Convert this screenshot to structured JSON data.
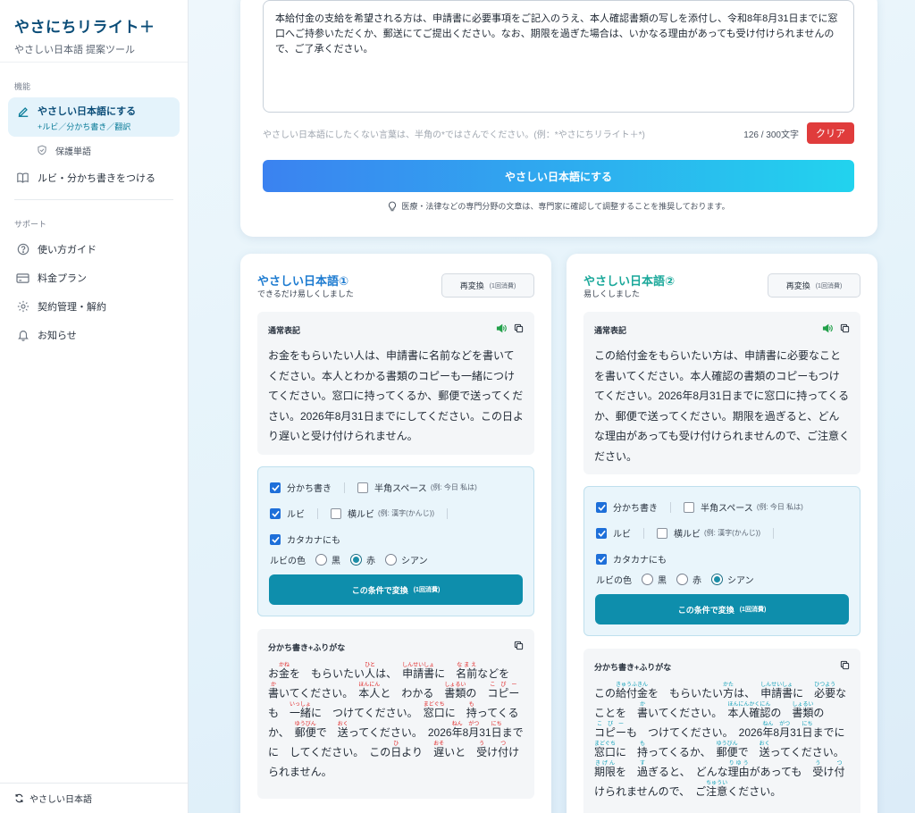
{
  "sidebar": {
    "brand_title": "やさにちリライト＋",
    "brand_sub": "やさしい日本語 提案ツール",
    "section_features": "機能",
    "active_item": {
      "label": "やさしい日本語にする",
      "sub": "+ルビ／分かち書き／翻訳"
    },
    "sub_item": "保護単語",
    "ruby_item": "ルビ・分かち書きをつける",
    "section_support": "サポート",
    "support_items": [
      "使い方ガイド",
      "料金プラン",
      "契約管理・解約",
      "お知らせ"
    ],
    "footer": "やさしい日本語"
  },
  "input": {
    "source_text": "本給付金の支給を希望される方は、申請書に必要事項をご記入のうえ、本人確認書類の写しを添付し、令和8年8月31日までに窓口へご持参いただくか、郵送にてご提出ください。なお、期限を過ぎた場合は、いかなる理由があっても受け付けられませんので、ご了承ください。",
    "hint": "やさしい日本語にしたくない言葉は、半角の*ではさんでください。(例：*やさにちリライト＋*)",
    "counter": "126 / 300文字",
    "clear_label": "クリア",
    "convert_label": "やさしい日本語にする",
    "note": "医療・法律などの専門分野の文章は、専門家に確認して調整することを推奨しております。"
  },
  "results": [
    {
      "title": "やさしい日本語①",
      "subtitle": "できるだけ易しくしました",
      "reconvert_label": "再変換",
      "reconvert_cost": "(1回消費)",
      "normal_label": "通常表記",
      "normal_text": "お金をもらいたい人は、申請書に名前などを書いてください。本人とわかる書類のコピーも一緒につけてください。窓口に持ってくるか、郵便で送ってください。2026年8月31日までにしてください。この日より遅いと受け付けられません。",
      "options": {
        "wakachi": {
          "label": "分かち書き",
          "checked": true
        },
        "hankaku": {
          "label": "半角スペース",
          "example": "(例: 今日 私は)",
          "checked": false
        },
        "ruby": {
          "label": "ルビ",
          "checked": true
        },
        "yoko_ruby": {
          "label": "横ルビ",
          "example": "(例: 漢字(かんじ))",
          "checked": false
        },
        "katakana": {
          "label": "カタカナにも",
          "checked": true
        },
        "ruby_color_label": "ルビの色",
        "colors": [
          "黒",
          "赤",
          "シアン"
        ],
        "selected_color": "赤"
      },
      "apply_label": "この条件で変換",
      "apply_cost": "(1回消費)",
      "ruby_label": "分かち書き+ふりがな",
      "ruby_color": "#e02424",
      "ruby_segments": [
        {
          "t": "お"
        },
        {
          "t": "金",
          "r": "かね"
        },
        {
          "t": "を　もらいたい"
        },
        {
          "t": "人",
          "r": "ひと"
        },
        {
          "t": "は、　"
        },
        {
          "t": "申請書",
          "r": "しんせいしょ"
        },
        {
          "t": "に　"
        },
        {
          "t": "名前",
          "r": "なまえ"
        },
        {
          "t": "などを　"
        },
        {
          "t": "書",
          "r": "か"
        },
        {
          "t": "いてください。　"
        },
        {
          "t": "本人",
          "r": "ほんにん"
        },
        {
          "t": "と　わかる　"
        },
        {
          "t": "書類",
          "r": "しょるい"
        },
        {
          "t": "の　"
        },
        {
          "t": "コピー",
          "r": "こぴー"
        },
        {
          "t": "も　"
        },
        {
          "t": "一緒",
          "r": "いっしょ"
        },
        {
          "t": "に　つけてください。　"
        },
        {
          "t": "窓口",
          "r": "まどぐち"
        },
        {
          "t": "に　"
        },
        {
          "t": "持",
          "r": "も"
        },
        {
          "t": "ってくるか、　"
        },
        {
          "t": "郵便",
          "r": "ゆうびん"
        },
        {
          "t": "で　"
        },
        {
          "t": "送",
          "r": "おく"
        },
        {
          "t": "ってください。　2026"
        },
        {
          "t": "年",
          "r": "ねん"
        },
        {
          "t": "8"
        },
        {
          "t": "月",
          "r": "がつ"
        },
        {
          "t": "31"
        },
        {
          "t": "日",
          "r": "にち"
        },
        {
          "t": "までに　してください。　この"
        },
        {
          "t": "日",
          "r": "ひ"
        },
        {
          "t": "より　"
        },
        {
          "t": "遅",
          "r": "おそ"
        },
        {
          "t": "いと　"
        },
        {
          "t": "受",
          "r": "う"
        },
        {
          "t": "け"
        },
        {
          "t": "付",
          "r": "つ"
        },
        {
          "t": "けられません。"
        }
      ]
    },
    {
      "title": "やさしい日本語②",
      "subtitle": "易しくしました",
      "reconvert_label": "再変換",
      "reconvert_cost": "(1回消費)",
      "normal_label": "通常表記",
      "normal_text": "この給付金をもらいたい方は、申請書に必要なことを書いてください。本人確認の書類のコピーもつけてください。2026年8月31日までに窓口に持ってくるか、郵便で送ってください。期限を過ぎると、どんな理由があっても受け付けられませんので、ご注意ください。",
      "options": {
        "wakachi": {
          "label": "分かち書き",
          "checked": true
        },
        "hankaku": {
          "label": "半角スペース",
          "example": "(例: 今日 私は)",
          "checked": false
        },
        "ruby": {
          "label": "ルビ",
          "checked": true
        },
        "yoko_ruby": {
          "label": "横ルビ",
          "example": "(例: 漢字(かんじ))",
          "checked": false
        },
        "katakana": {
          "label": "カタカナにも",
          "checked": true
        },
        "ruby_color_label": "ルビの色",
        "colors": [
          "黒",
          "赤",
          "シアン"
        ],
        "selected_color": "シアン"
      },
      "apply_label": "この条件で変換",
      "apply_cost": "(1回消費)",
      "ruby_label": "分かち書き+ふりがな",
      "ruby_color": "#0e9fb8",
      "ruby_segments": [
        {
          "t": "この"
        },
        {
          "t": "給付金",
          "r": "きゅうふきん"
        },
        {
          "t": "を　もらいたい"
        },
        {
          "t": "方",
          "r": "かた"
        },
        {
          "t": "は、　"
        },
        {
          "t": "申請書",
          "r": "しんせいしょ"
        },
        {
          "t": "に　"
        },
        {
          "t": "必要",
          "r": "ひつよう"
        },
        {
          "t": "なことを　"
        },
        {
          "t": "書",
          "r": "か"
        },
        {
          "t": "いてください。　"
        },
        {
          "t": "本人確認",
          "r": "ほんにんかくにん"
        },
        {
          "t": "の　"
        },
        {
          "t": "書類",
          "r": "しょるい"
        },
        {
          "t": "の　"
        },
        {
          "t": "コピー",
          "r": "こぴー"
        },
        {
          "t": "も　つけてください。　2026"
        },
        {
          "t": "年",
          "r": "ねん"
        },
        {
          "t": "8"
        },
        {
          "t": "月",
          "r": "がつ"
        },
        {
          "t": "31"
        },
        {
          "t": "日",
          "r": "にち"
        },
        {
          "t": "までに　"
        },
        {
          "t": "窓口",
          "r": "まどぐち"
        },
        {
          "t": "に　"
        },
        {
          "t": "持",
          "r": "も"
        },
        {
          "t": "ってくるか、　"
        },
        {
          "t": "郵便",
          "r": "ゆうびん"
        },
        {
          "t": "で　"
        },
        {
          "t": "送",
          "r": "おく"
        },
        {
          "t": "ってください。　"
        },
        {
          "t": "期限",
          "r": "きげん"
        },
        {
          "t": "を　"
        },
        {
          "t": "過",
          "r": "す"
        },
        {
          "t": "ぎると、　どんな"
        },
        {
          "t": "理由",
          "r": "りゆう"
        },
        {
          "t": "があっても　"
        },
        {
          "t": "受",
          "r": "う"
        },
        {
          "t": "け"
        },
        {
          "t": "付",
          "r": "つ"
        },
        {
          "t": "けられませんので、　ご"
        },
        {
          "t": "注意",
          "r": "ちゅうい"
        },
        {
          "t": "ください。"
        }
      ]
    }
  ],
  "colors": {
    "accent": "#0b4d78",
    "primary_btn": "#0e8eac",
    "danger": "#e03c3c",
    "title_blue": "#1d7bd0"
  }
}
